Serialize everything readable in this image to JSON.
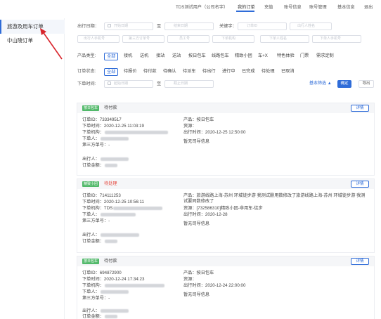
{
  "topbar": {
    "account": "TDS测试用户（公司名字）",
    "nav": [
      "我的订单",
      "充值",
      "账号信息",
      "账号管理",
      "基本信息",
      "退出"
    ]
  },
  "sidebar": {
    "items": [
      {
        "label": "旅游及用车订单",
        "active": true
      },
      {
        "label": "中山陵订单",
        "active": false
      }
    ]
  },
  "filters": {
    "departure_date_label": "出行日期：",
    "date_start_placeholder": "开始日期",
    "date_to": "至",
    "date_end_placeholder": "结束日期",
    "keyword_label": "关键字：",
    "order_id_placeholder": "订单ID",
    "traveler_placeholder": "出行人姓名",
    "traveler_phone_placeholder": "出行人手机号",
    "third_party_placeholder": "第三方订单号",
    "employee_id_placeholder": "员工号",
    "orderer_org_placeholder": "下单机构",
    "orderer_name_placeholder": "下单人姓名",
    "orderer_phone_placeholder": "下单人手机号",
    "product_type_label": "产品类型:",
    "product_types": [
      "全部",
      "接机",
      "送机",
      "接站",
      "送站",
      "按日包车",
      "线路包车",
      "精致小团",
      "车+X",
      "特色体验",
      "门票",
      "需求定制"
    ],
    "order_status_label": "订单状态:",
    "order_statuses": [
      "全部",
      "待报价",
      "待付款",
      "待确认",
      "待派车",
      "待出行",
      "进行中",
      "已完成",
      "待处理",
      "已取消"
    ],
    "order_time_label": "下单时间:",
    "order_time_start_placeholder": "起始日期",
    "order_time_end_placeholder": "截止日期",
    "advanced_filter": "基本筛选",
    "confirm": "确定",
    "export": "导出"
  },
  "orders": [
    {
      "tag": "按日包车",
      "status": "待付款",
      "status_color": "#444444",
      "detail": "详情",
      "order_id": "订单ID：733349517",
      "order_time": "下单时间：2020-12-25 11:03:19",
      "org": "下单机构：",
      "orderer": "下单人：",
      "third_party": "第三方单号：-",
      "traveler": "出行人：",
      "amount": "订单金额：",
      "product": "产品：按日包车",
      "resource": "资源：",
      "depart": "出行时间：2020-12-25 12:50:00",
      "driver": "暂无司导信息"
    },
    {
      "tag": "精致小团",
      "status": "待处理",
      "status_color": "#e5463b",
      "detail": "详情",
      "order_id": "订单ID：714111253",
      "order_time": "下单时间：2020-12-25 10:56:11",
      "org": "下单机构：TDS",
      "orderer": "下单人：",
      "third_party": "第三方单号：-",
      "traveler": "出行人：",
      "amount": "订单金额：",
      "product": "产品：旅游线路上海-苏州 环城徒步游 我测试删用数修改了旅游线路上海-苏州 环城徒步游 我测试要同数修改了",
      "resource": "资源：[732586310]精致小团-非用车-徒步",
      "depart": "出行时间：2020-12-28",
      "driver": "暂无司导信息"
    },
    {
      "tag": "按日包车",
      "status": "待付款",
      "status_color": "#444444",
      "detail": "详情",
      "order_id": "订单ID：694872900",
      "order_time": "下单时间：2020-12-24 17:34:23",
      "org": "下单机构：",
      "orderer": "下单人：",
      "third_party": "第三方单号：-",
      "traveler": "出行人：",
      "amount": "订单金额：",
      "product": "产品：按日包车",
      "resource": "资源：",
      "depart": "出行时间：2020-12-24 22:00:00",
      "driver": "暂无司导信息"
    }
  ]
}
